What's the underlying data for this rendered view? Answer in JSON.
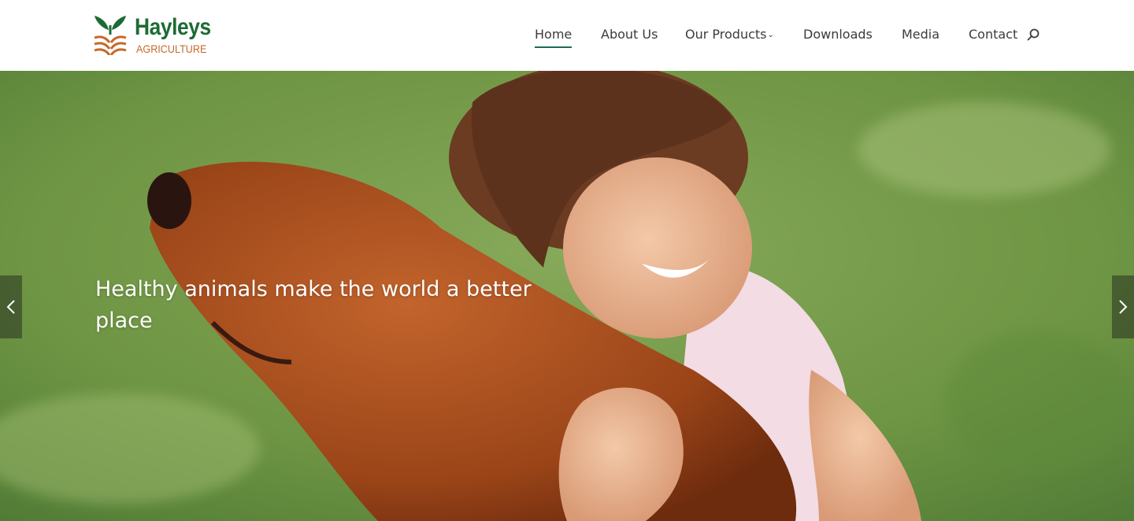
{
  "brand": {
    "name": "Hayleys",
    "tagline": "AGRICULTURE",
    "colors": {
      "green": "#1d6b34",
      "orange": "#c46a2a"
    }
  },
  "nav": {
    "items": [
      {
        "label": "Home",
        "active": true
      },
      {
        "label": "About Us",
        "active": false
      },
      {
        "label": "Our Products",
        "active": false,
        "has_dropdown": true
      },
      {
        "label": "Downloads",
        "active": false
      },
      {
        "label": "Media",
        "active": false
      },
      {
        "label": "Contact",
        "active": false
      }
    ],
    "search_icon": "search-icon",
    "active_underline_color": "#1d6b5a"
  },
  "hero": {
    "caption": "Healthy animals make the world a better place",
    "prev_icon": "chevron-left-icon",
    "next_icon": "chevron-right-icon"
  }
}
